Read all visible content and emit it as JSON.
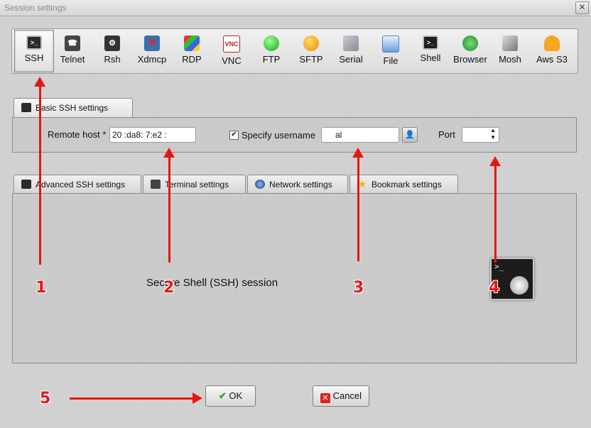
{
  "window": {
    "title": "Session settings",
    "close_glyph": "✕"
  },
  "session_types": [
    {
      "label": "SSH",
      "icon": "ssh-terminal-icon",
      "active": true
    },
    {
      "label": "Telnet",
      "icon": "telnet-icon"
    },
    {
      "label": "Rsh",
      "icon": "rsh-icon"
    },
    {
      "label": "Xdmcp",
      "icon": "xdmcp-icon"
    },
    {
      "label": "RDP",
      "icon": "rdp-icon"
    },
    {
      "label": "VNC",
      "icon": "vnc-icon"
    },
    {
      "label": "FTP",
      "icon": "ftp-globe-icon"
    },
    {
      "label": "SFTP",
      "icon": "sftp-icon"
    },
    {
      "label": "Serial",
      "icon": "serial-cable-icon"
    },
    {
      "label": "File",
      "icon": "file-icon"
    },
    {
      "label": "Shell",
      "icon": "shell-icon"
    },
    {
      "label": "Browser",
      "icon": "browser-icon"
    },
    {
      "label": "Mosh",
      "icon": "mosh-icon"
    },
    {
      "label": "Aws S3",
      "icon": "aws-s3-icon"
    }
  ],
  "basic_tab": {
    "label": "Basic SSH settings"
  },
  "basic": {
    "remote_host_label": "Remote host *",
    "remote_host_value": "20   :da8:   7:e2   :",
    "specify_username_label": "Specify username",
    "username_value": "al",
    "port_label": "Port",
    "port_value": ""
  },
  "tabs": [
    {
      "label": "Advanced SSH settings"
    },
    {
      "label": "Terminal settings"
    },
    {
      "label": "Network settings"
    },
    {
      "label": "Bookmark settings"
    }
  ],
  "panel": {
    "caption": "Secure Shell (SSH) session",
    "prompt_glyph": ">_"
  },
  "buttons": {
    "ok": "OK",
    "cancel": "Cancel"
  },
  "annotations": [
    "1",
    "2",
    "3",
    "4",
    "5"
  ],
  "colors": {
    "annotation": "#e81515",
    "accent_green": "#2aa52a",
    "cancel_red": "#d22"
  }
}
